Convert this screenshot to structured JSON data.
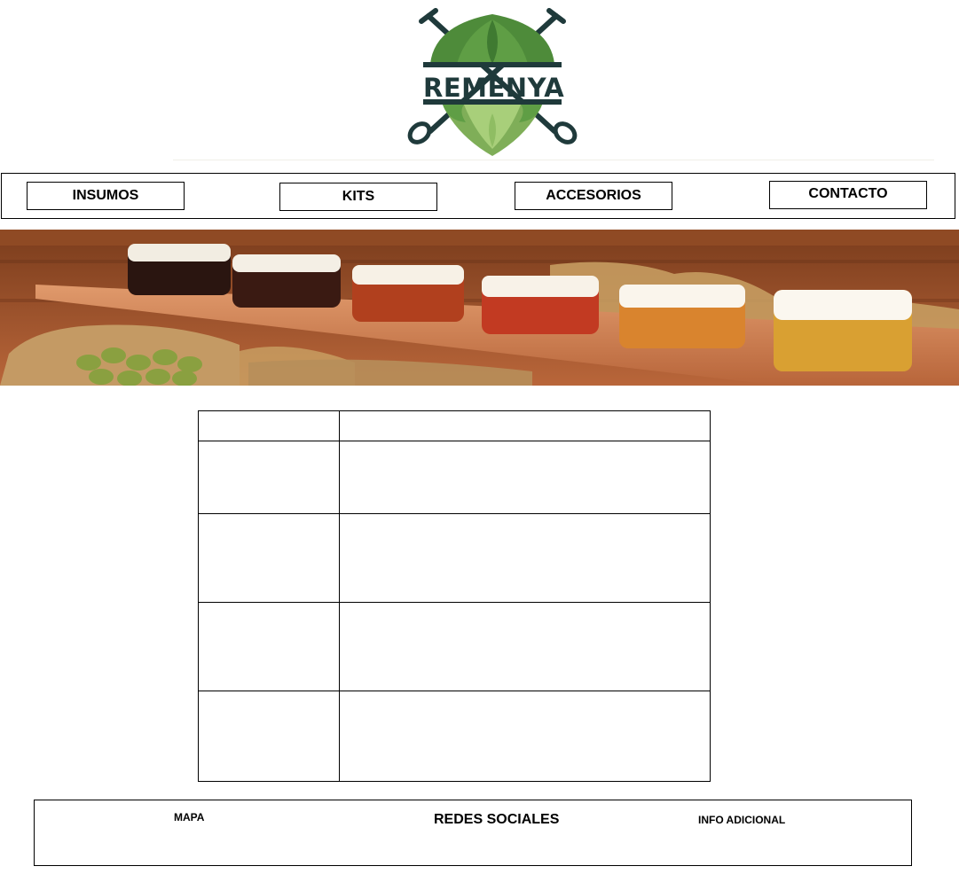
{
  "logo": {
    "name": "REMENYA",
    "icon": "hop-cone-crossed-tools-logo"
  },
  "nav": {
    "items": [
      {
        "label": "INSUMOS"
      },
      {
        "label": "KITS"
      },
      {
        "label": "ACCESORIOS"
      },
      {
        "label": "CONTACTO"
      }
    ]
  },
  "banner": {
    "image": "beer-tasting-flight-photo"
  },
  "content_table": {
    "rows": [
      [
        "",
        ""
      ],
      [
        "",
        ""
      ],
      [
        "",
        ""
      ],
      [
        "",
        ""
      ],
      [
        "",
        ""
      ]
    ]
  },
  "footer": {
    "map_label": "MAPA",
    "social_label": "REDES SOCIALES",
    "info_label": "INFO ADICIONAL"
  },
  "colors": {
    "logo_dark": "#1f3a3b",
    "hop_green": "#4e8b3a",
    "hop_light": "#a8cf7a",
    "wood": "#c8764a"
  }
}
